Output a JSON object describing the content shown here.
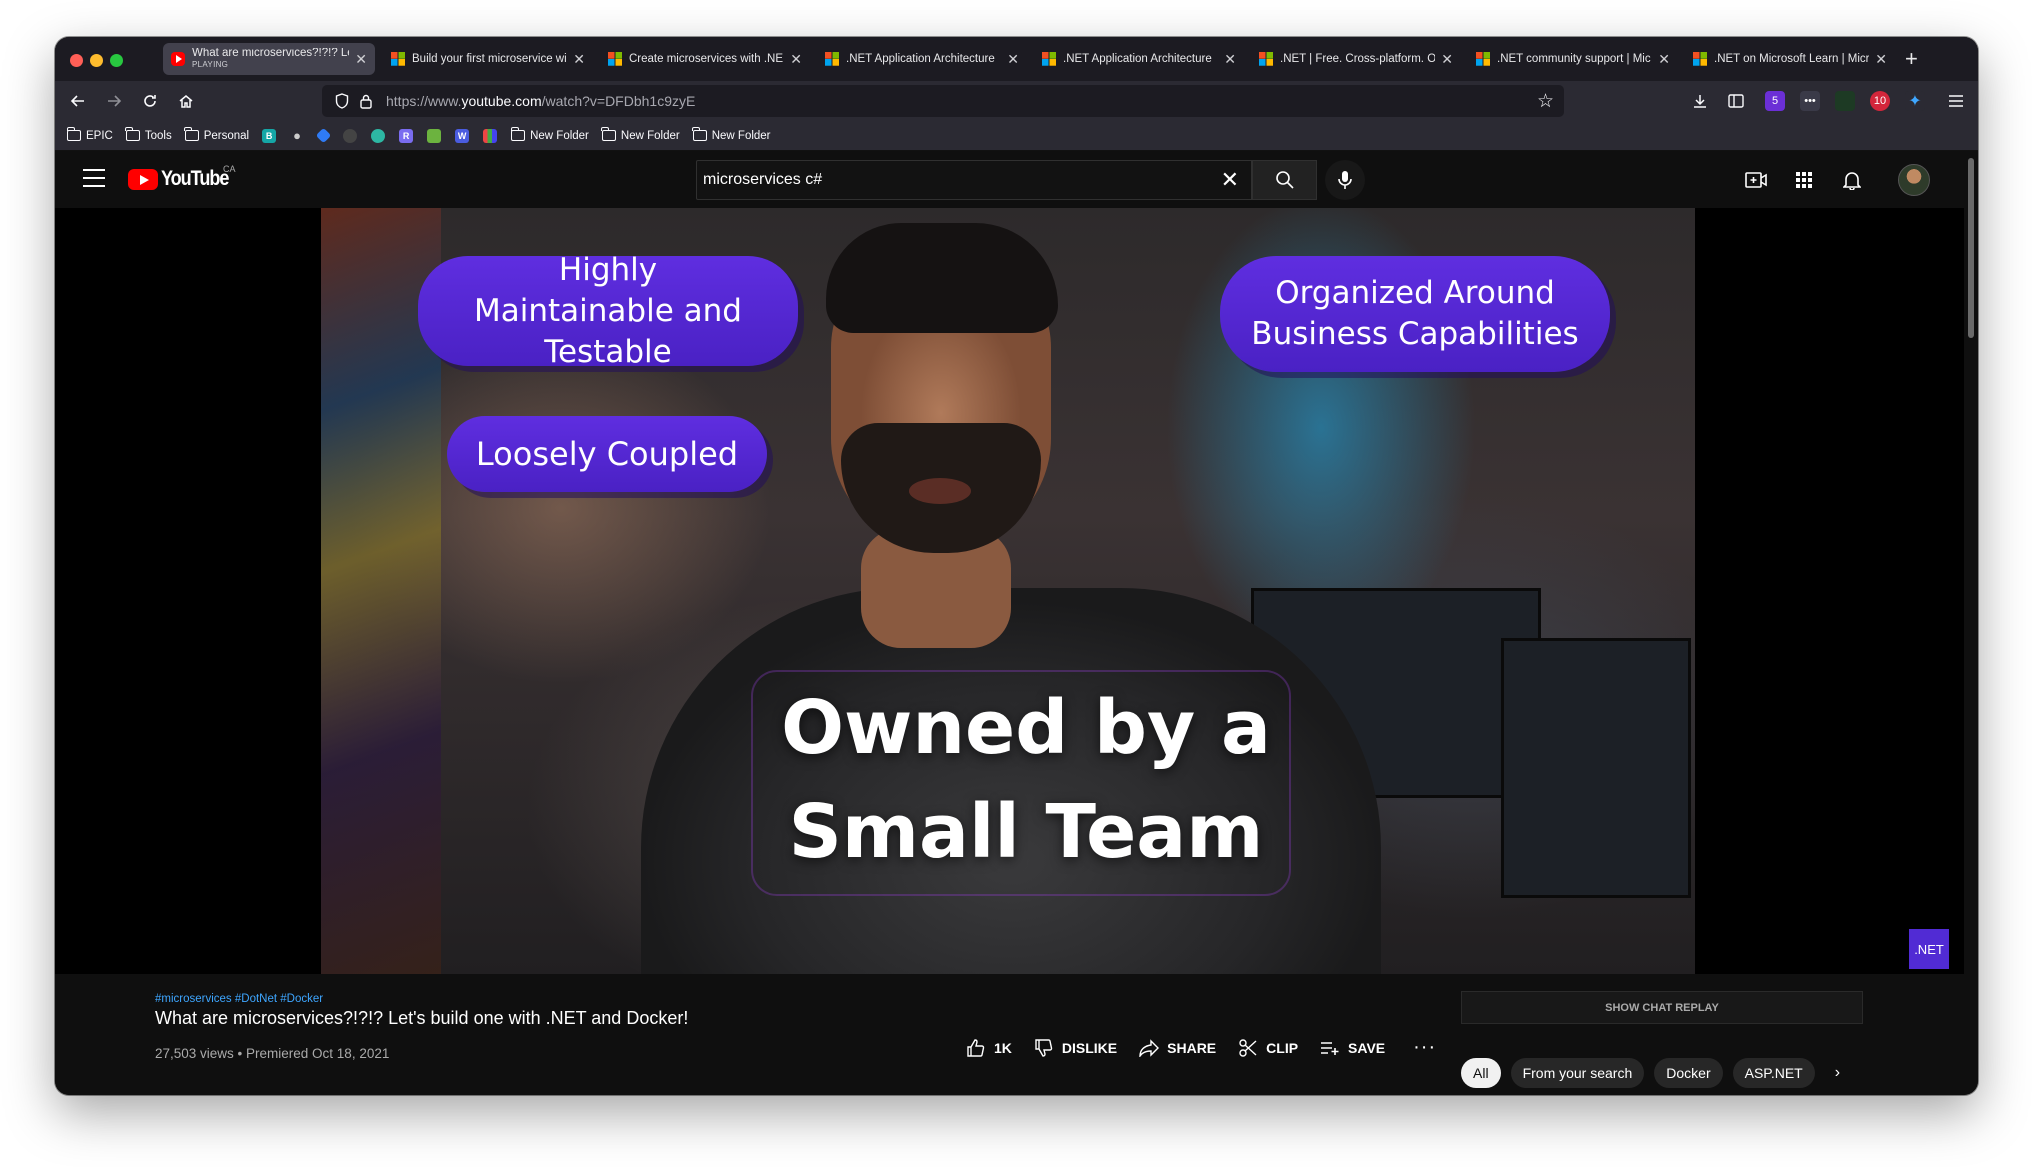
{
  "browser": {
    "tabs": [
      {
        "title": "What are microservices?!?!? Le",
        "subtitle": "PLAYING",
        "favicon": "youtube-icon",
        "active": true
      },
      {
        "title": "Build your first microservice wi",
        "favicon": "microsoft-icon"
      },
      {
        "title": "Create microservices with .NE",
        "favicon": "microsoft-icon"
      },
      {
        "title": ".NET Application Architecture",
        "favicon": "microsoft-icon"
      },
      {
        "title": ".NET Application Architecture",
        "favicon": "microsoft-icon"
      },
      {
        "title": ".NET | Free. Cross-platform. O",
        "favicon": "microsoft-icon"
      },
      {
        "title": ".NET community support | Mic",
        "favicon": "microsoft-icon"
      },
      {
        "title": ".NET on Microsoft Learn | Micr",
        "favicon": "microsoft-icon"
      }
    ],
    "url_prefix": "https://www.",
    "url_domain": "youtube.com",
    "url_path": "/watch?v=DFDbh1c9zyE",
    "extension_badges": {
      "first": "5",
      "second": "10"
    },
    "bookmarks": [
      {
        "label": "EPIC"
      },
      {
        "label": "Tools"
      },
      {
        "label": "Personal"
      }
    ],
    "bookmark_folders_after": [
      {
        "label": "New Folder"
      },
      {
        "label": "New Folder"
      },
      {
        "label": "New Folder"
      }
    ]
  },
  "youtube": {
    "logo_text": "YouTube",
    "region": "CA",
    "search_query": "microservices c#"
  },
  "video": {
    "overlays": {
      "bubble_1": "Highly Maintainable and Testable",
      "bubble_2": "Organized Around Business Capabilities",
      "bubble_3": "Loosely Coupled",
      "caption": "Owned by a Small Team",
      "badge": ".NET"
    },
    "hashtags": "#microservices #DotNet #Docker",
    "title": "What are microservices?!?!? Let's build one with .NET and Docker!",
    "meta": "27,503 views • Premiered Oct 18, 2021",
    "actions": {
      "like": "1K",
      "dislike": "DISLIKE",
      "share": "SHARE",
      "clip": "CLIP",
      "save": "SAVE"
    }
  },
  "sidebar": {
    "chat_replay": "SHOW CHAT REPLAY",
    "chips": [
      "All",
      "From your search",
      "Docker",
      "ASP.NET"
    ]
  },
  "colors": {
    "youtube_red": "#ff0000",
    "bubble_purple": "#5a2ad9",
    "link_blue": "#3ea6ff",
    "dotnet_purple": "#512bd4"
  }
}
